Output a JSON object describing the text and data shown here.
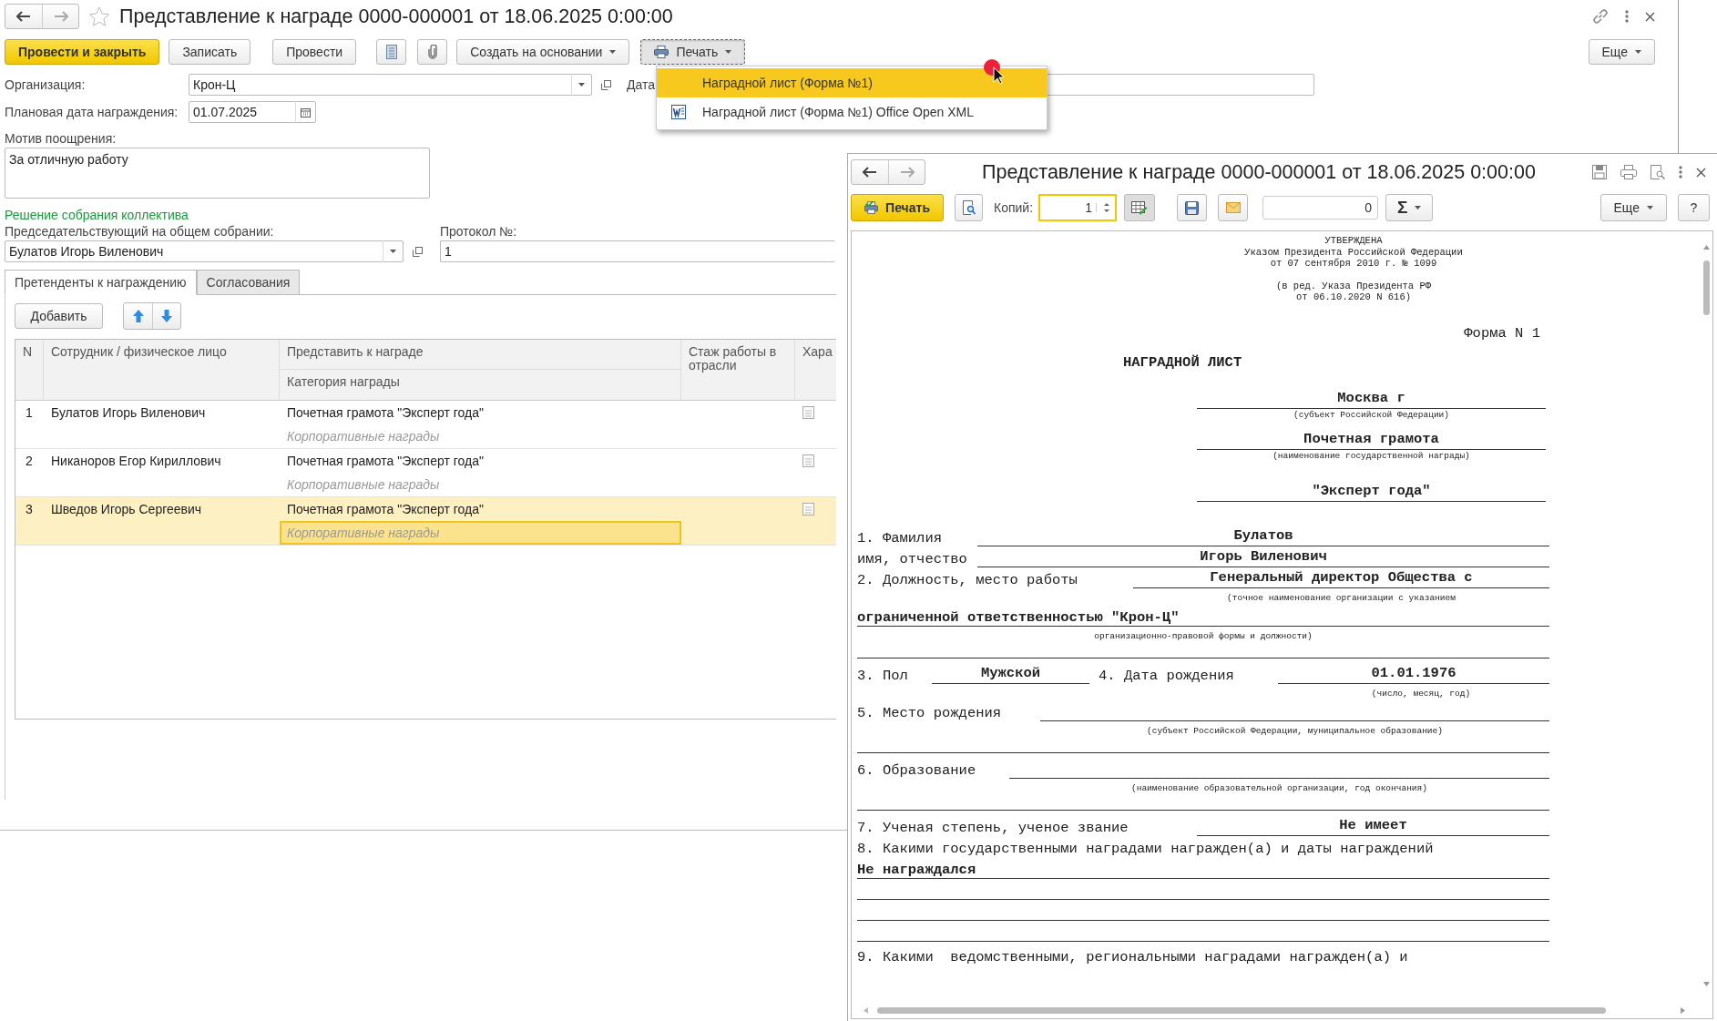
{
  "window": {
    "title": "Представление к награде 0000-000001 от 18.06.2025 0:00:00"
  },
  "toolbar": {
    "buttons": [
      {
        "label": "Провести и закрыть",
        "kind": "primary",
        "expanded": false
      },
      {
        "label": "Записать",
        "kind": "plain",
        "expanded": false
      },
      {
        "label": "Провести",
        "kind": "plain",
        "expanded": false
      },
      {
        "label": "Создать на основании",
        "kind": "dropdown",
        "expanded": false
      },
      {
        "label": "Печать",
        "kind": "print",
        "expanded": true
      }
    ],
    "more": "Еще"
  },
  "print_menu": {
    "items": [
      {
        "label": "Наградной лист (Форма №1)",
        "kind": "plain",
        "selected": true
      },
      {
        "label": "Наградной лист (Форма №1) Office Open XML",
        "kind": "word",
        "selected": false
      }
    ]
  },
  "form": {
    "organization": {
      "label": "Организация:",
      "value": "Крон-Ц"
    },
    "date": {
      "label": "Дата"
    },
    "planned_date": {
      "label": "Плановая дата награждения:",
      "value": "01.07.2025"
    },
    "motive": {
      "label": "Мотив поощрения:",
      "value": "За отличную работу"
    },
    "section_title": "Решение собрания коллектива",
    "chairman": {
      "label": "Председательствующий на общем собрании:",
      "value": "Булатов Игорь Виленович"
    },
    "protocol": {
      "label": "Протокол №:",
      "value": "1"
    }
  },
  "tabs": [
    {
      "label": "Претенденты к награждению",
      "selected": true
    },
    {
      "label": "Согласования",
      "selected": false
    }
  ],
  "table_toolbar": {
    "add": "Добавить"
  },
  "table": {
    "columns": {
      "n": "N",
      "employee": "Сотрудник / физическое лицо",
      "award": "Представить к награде",
      "category": "Категория награды",
      "experience": "Стаж работы в отрасли",
      "column_6": "Хара"
    },
    "rows": [
      {
        "n": "1",
        "employee": "Булатов Игорь Виленович",
        "award": "Почетная грамота \"Эксперт года\"",
        "category": "Корпоративные награды",
        "selected": false
      },
      {
        "n": "2",
        "employee": "Никаноров Егор Кириллович",
        "award": "Почетная грамота \"Эксперт года\"",
        "category": "Корпоративные награды",
        "selected": false
      },
      {
        "n": "3",
        "employee": "Шведов Игорь Сергеевич",
        "award": "Почетная грамота \"Эксперт года\"",
        "category": "Корпоративные награды",
        "selected": true
      }
    ]
  },
  "print_window": {
    "title": "Представление к награде 0000-000001 от 18.06.2025 0:00:00",
    "print_button": "Печать",
    "copies_label": "Копий:",
    "copies_value": "1",
    "sum_value": "0",
    "sum_button": "Σ",
    "more": "Еще",
    "help": "?"
  },
  "document": {
    "approval": [
      "УТВЕРЖДЕНА",
      "Указом Президента Российской Федерации",
      "от  07 сентября 2010 г. № 1099"
    ],
    "revision": [
      "(в ред. Указа Президента РФ",
      "от 06.10.2020 N 616)"
    ],
    "form_no": "Форма N 1",
    "heading": "НАГРАДНОЙ ЛИСТ",
    "region": {
      "value": "Москва г",
      "caption": "(субъект Российской Федерации)"
    },
    "award": {
      "value": "Почетная грамота",
      "caption": "(наименование государственной награды)"
    },
    "award_name": "\"Эксперт года\"",
    "surname": {
      "label": "1. Фамилия",
      "value": "Булатов"
    },
    "name": {
      "label": "имя, отчество",
      "value": "Игорь Виленович"
    },
    "position": {
      "label": "2. Должность, место работы",
      "value": "Генеральный директор Общества с",
      "caption": "(точное наименование организации с указанием",
      "value_2": "ограниченной ответственностью \"Крон-Ц\"",
      "caption_2": "организационно-правовой формы и должности)"
    },
    "gender": {
      "label": "3. Пол",
      "value": "Мужской"
    },
    "birth_date": {
      "label": "4. Дата рождения",
      "value": "01.01.1976",
      "caption": "(число, месяц, год)"
    },
    "birthplace": {
      "label": "5. Место рождения",
      "caption": "(субъект Российской Федерации, муниципальное образование)"
    },
    "education": {
      "label": "6. Образование",
      "caption": "(наименование образовательной организации, год окончания)"
    },
    "degree": {
      "label": "7. Ученая степень, ученое звание",
      "value": "Не имеет"
    },
    "state_awards": {
      "label": "8. Какими государственными наградами награжден(а) и даты награждений",
      "value": "Не награждался"
    },
    "other_awards": {
      "label": "9. Какими  ведомственными, региональными наградами награжден(а) и"
    }
  }
}
